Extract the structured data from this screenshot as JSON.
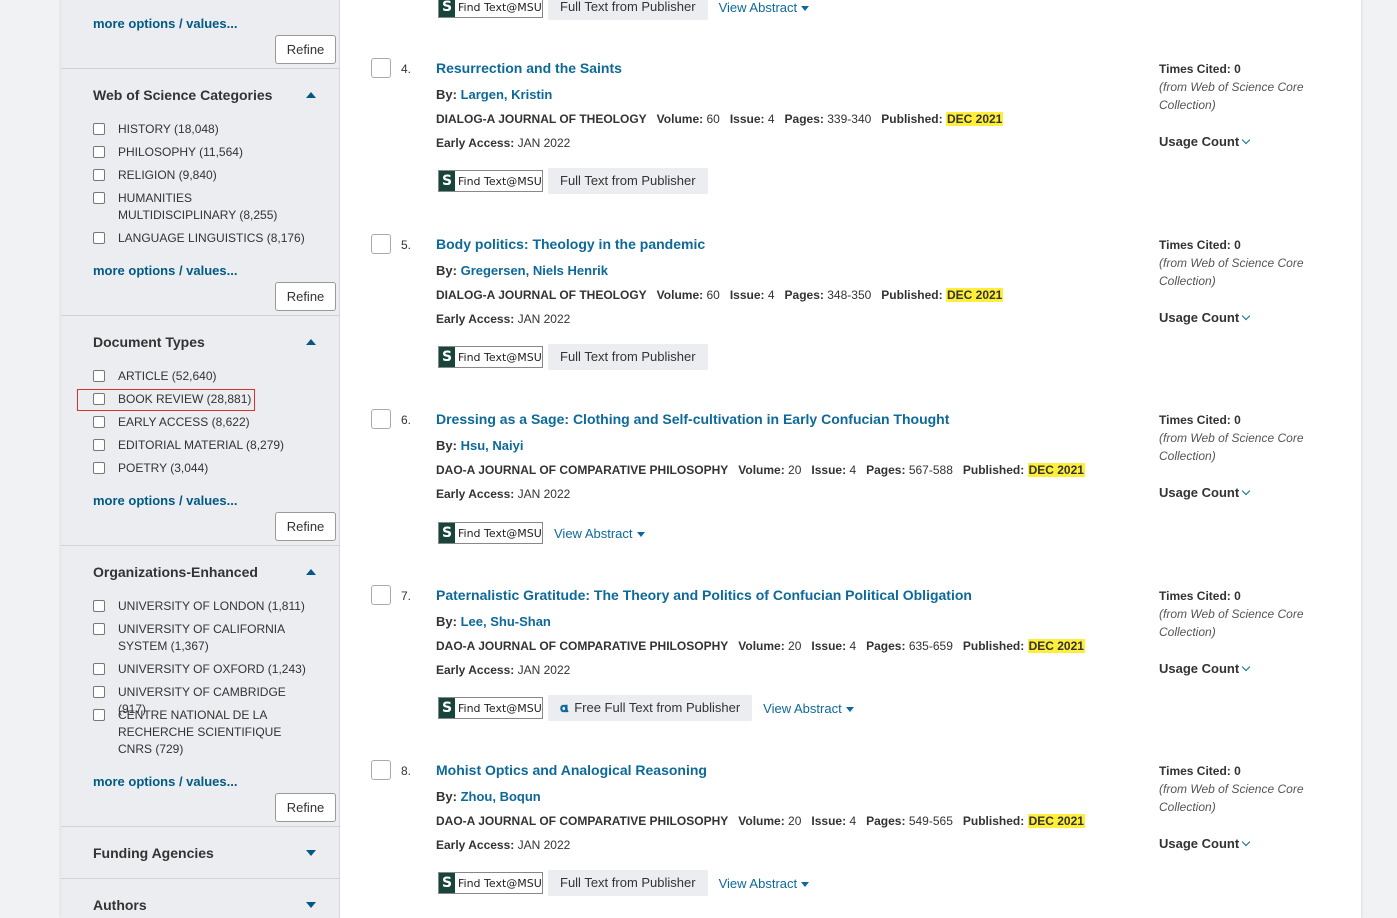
{
  "sidebar": {
    "top": {
      "more_label": "more options / values...",
      "refine_label": "Refine"
    },
    "categories": {
      "title": "Web of Science Categories",
      "items": [
        {
          "label": "HISTORY (18,048)"
        },
        {
          "label": "PHILOSOPHY (11,564)"
        },
        {
          "label": "RELIGION (9,840)"
        },
        {
          "label": "HUMANITIES MULTIDISCIPLINARY (8,255)"
        },
        {
          "label": "LANGUAGE LINGUISTICS (8,176)"
        }
      ],
      "more_label": "more options / values...",
      "refine_label": "Refine"
    },
    "doctypes": {
      "title": "Document Types",
      "items": [
        {
          "label": "ARTICLE (52,640)"
        },
        {
          "label": "BOOK REVIEW (28,881)"
        },
        {
          "label": "EARLY ACCESS (8,622)"
        },
        {
          "label": "EDITORIAL MATERIAL (8,279)"
        },
        {
          "label": "POETRY (3,044)"
        }
      ],
      "more_label": "more options / values...",
      "refine_label": "Refine"
    },
    "orgs": {
      "title": "Organizations-Enhanced",
      "items": [
        {
          "label": "UNIVERSITY OF LONDON (1,811)"
        },
        {
          "label": "UNIVERSITY OF CALIFORNIA SYSTEM (1,367)"
        },
        {
          "label": "UNIVERSITY OF OXFORD (1,243)"
        },
        {
          "label": "UNIVERSITY OF CAMBRIDGE (917)"
        },
        {
          "label": "CENTRE NATIONAL DE LA RECHERCHE SCIENTIFIQUE CNRS (729)"
        }
      ],
      "more_label": "more options / values...",
      "refine_label": "Refine"
    },
    "funding": {
      "title": "Funding Agencies"
    },
    "authors": {
      "title": "Authors"
    }
  },
  "common": {
    "find_text": "Find Text@MSU",
    "find_text_letter": "S",
    "full_text": "Full Text from Publisher",
    "free_full_text": "Free Full Text from Publisher",
    "view_abstract": "View Abstract",
    "by": "By:",
    "volume": "Volume:",
    "issue": "Issue:",
    "pages": "Pages:",
    "published": "Published:",
    "early_access": "Early Access:",
    "times_cited": "Times Cited: 0",
    "from_core": "(from Web of Science Core Collection)",
    "usage_count": "Usage Count"
  },
  "records": [
    {
      "num": "4.",
      "title": "Resurrection and the Saints",
      "authors": "Largen, Kristin",
      "journal": "DIALOG-A JOURNAL OF THEOLOGY",
      "volume": "60",
      "issue": "4",
      "pages": "339-340",
      "published": "DEC 2021",
      "early": "JAN 2022"
    },
    {
      "num": "5.",
      "title": "Body politics: Theology in the pandemic",
      "authors": "Gregersen, Niels Henrik",
      "journal": "DIALOG-A JOURNAL OF THEOLOGY",
      "volume": "60",
      "issue": "4",
      "pages": "348-350",
      "published": "DEC 2021",
      "early": "JAN 2022"
    },
    {
      "num": "6.",
      "title": "Dressing as a Sage: Clothing and Self-cultivation in Early Confucian Thought",
      "authors": "Hsu, Naiyi",
      "journal": "DAO-A JOURNAL OF COMPARATIVE PHILOSOPHY",
      "volume": "20",
      "issue": "4",
      "pages": "567-588",
      "published": "DEC 2021",
      "early": "JAN 2022"
    },
    {
      "num": "7.",
      "title": "Paternalistic Gratitude: The Theory and Politics of Confucian Political Obligation",
      "authors": "Lee, Shu-Shan",
      "journal": "DAO-A JOURNAL OF COMPARATIVE PHILOSOPHY",
      "volume": "20",
      "issue": "4",
      "pages": "635-659",
      "published": "DEC 2021",
      "early": "JAN 2022"
    },
    {
      "num": "8.",
      "title": "Mohist Optics and Analogical Reasoning",
      "authors": "Zhou, Boqun",
      "journal": "DAO-A JOURNAL OF COMPARATIVE PHILOSOPHY",
      "volume": "20",
      "issue": "4",
      "pages": "549-565",
      "published": "DEC 2021",
      "early": "JAN 2022"
    }
  ]
}
